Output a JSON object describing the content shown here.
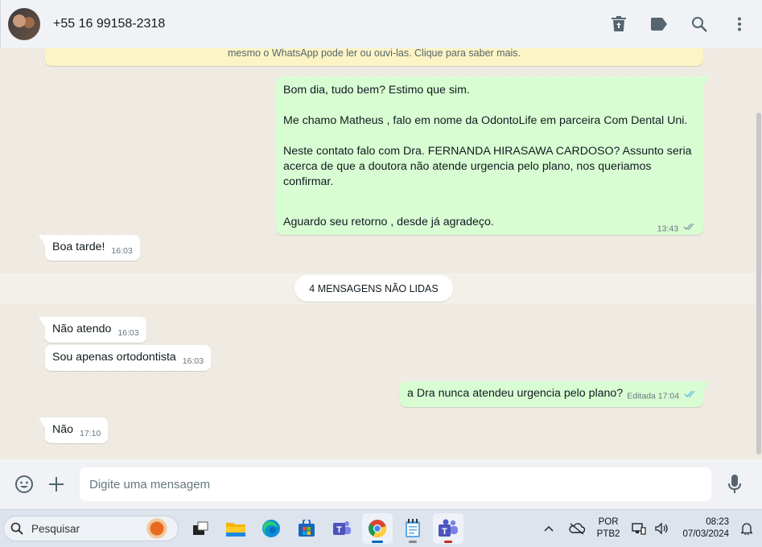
{
  "header": {
    "contact_name": "+55 16 99158-2318",
    "icons": [
      "delete-icon",
      "label-icon",
      "search-icon",
      "menu-icon"
    ]
  },
  "chat": {
    "encryption_notice": "mesmo o WhatsApp pode ler ou ouvi-las. Clique para saber mais.",
    "messages": [
      {
        "direction": "outgoing",
        "paragraphs": [
          "Bom dia, tudo bem? Estimo que sim.",
          "Me chamo Matheus , falo em nome da OdontoLife em parceira Com Dental Uni.",
          "Neste contato falo com Dra. FERNANDA HIRASAWA CARDOSO? Assunto seria acerca de que a doutora não atende urgencia pelo plano, nos queriamos confirmar.",
          "Aguardo seu retorno , desde já agradeço."
        ],
        "time": "13:43"
      },
      {
        "direction": "incoming",
        "text": "Boa tarde!",
        "time": "16:03"
      },
      {
        "direction": "incoming",
        "text": "Não atendo",
        "time": "16:03"
      },
      {
        "direction": "incoming",
        "text": "Sou apenas ortodontista",
        "time": "16:03"
      },
      {
        "direction": "outgoing",
        "text": "a Dra nunca atendeu urgencia pelo plano?",
        "edited_label": "Editada",
        "time": "17:04"
      },
      {
        "direction": "incoming",
        "text": "Não",
        "time": "17:10"
      }
    ],
    "unread_divider": "4 MENSAGENS NÃO LIDAS"
  },
  "composer": {
    "placeholder": "Digite uma mensagem",
    "value": ""
  },
  "taskbar": {
    "search_placeholder": "Pesquisar",
    "apps": [
      "task-view",
      "file-explorer",
      "edge",
      "microsoft-store",
      "teams-classic",
      "chrome",
      "notepad",
      "teams"
    ],
    "language_line1": "POR",
    "language_line2": "PTB2",
    "time": "08:23",
    "date": "07/03/2024"
  },
  "colors": {
    "outgoing_bubble": "#d9fdd3",
    "incoming_bubble": "#ffffff",
    "chat_background": "#efeae2",
    "header_background": "#f0f2f5",
    "read_ticks": "#53bdeb"
  }
}
